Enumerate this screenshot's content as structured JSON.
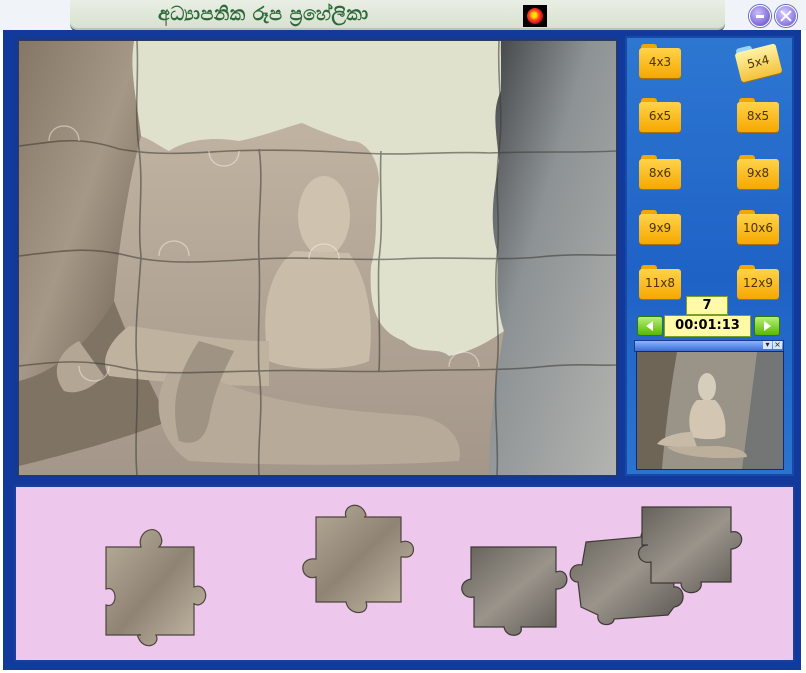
{
  "window": {
    "title": "අධ්‍යාපනික රූප ප්‍රහේලිකා",
    "app_icon": "puzzle-app-icon",
    "controls": [
      "minimize-icon",
      "close-icon"
    ]
  },
  "sidebar": {
    "grid_sizes": [
      "4x3",
      "5x4",
      "6x5",
      "8x5",
      "8x6",
      "9x8",
      "9x9",
      "10x6",
      "11x8",
      "12x9"
    ],
    "selected_grid": "5x4",
    "move_count": "7",
    "elapsed_time": "00:01:13",
    "prev_icon": "left-arrow-icon",
    "next_icon": "right-arrow-icon",
    "preview_controls": [
      "dropdown-icon",
      "close-icon"
    ]
  },
  "board": {
    "image_subject": "stone-carved-statue",
    "empty_color": "#dfe1cd"
  },
  "tray": {
    "loose_piece_count": 5,
    "background": "#edc7ec"
  },
  "colors": {
    "frame": "#123a9d",
    "sidebar": "#2269c9",
    "folder": "#f6a800",
    "timer_bg": "#fff9a8"
  }
}
